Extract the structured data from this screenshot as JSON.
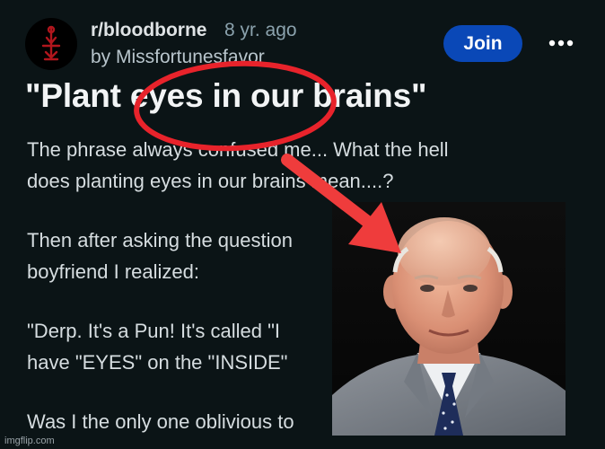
{
  "post": {
    "subreddit": "r/bloodborne",
    "age": "8 yr. ago",
    "author": "by Missfortunesfavor",
    "join_label": "Join",
    "title": "\"Plant eyes in our brains\"",
    "paragraphs": [
      [
        "The phrase always confused me... What the hell",
        "does planting eyes in our brains mean....?"
      ],
      [
        "Then after asking the question",
        "boyfriend I realized:"
      ],
      [
        "\"Derp. It's a Pun! It's called \"I",
        "have \"EYES\" on the \"INSIDE\""
      ],
      [
        "Was I the only one oblivious to"
      ]
    ]
  },
  "icons": {
    "avatar": "bloodborne-hunter-sigil-icon",
    "more": "more-horizontal-icon"
  },
  "annotations": {
    "circle_color": "#e8232b",
    "arrow_color": "#ef3c3c"
  },
  "colors": {
    "background": "#0b1416",
    "join_button": "#0a48b7"
  },
  "watermark": "imgflip.com"
}
